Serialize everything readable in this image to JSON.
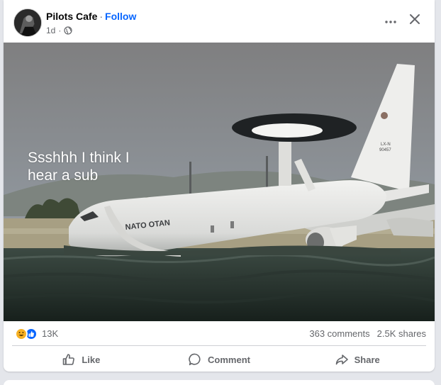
{
  "post": {
    "page_name": "Pilots Cafe",
    "separator": "·",
    "follow_label": "Follow",
    "time": "1d",
    "meta_separator": "·",
    "audience_icon": "globe-icon",
    "more_icon": "more-horizontal-icon",
    "close_icon": "close-icon"
  },
  "image": {
    "caption_line1": "Ssshhh I think I",
    "caption_line2": "hear a sub",
    "plane_marking": "NATO OTAN",
    "tail_marking_1": "LX-N",
    "tail_marking_2": "90457"
  },
  "stats": {
    "reaction_icons": [
      "haha-icon",
      "like-icon"
    ],
    "reaction_count": "13K",
    "comments": "363 comments",
    "shares": "2.5K shares"
  },
  "actions": [
    {
      "label": "Like",
      "icon": "thumbs-up-icon"
    },
    {
      "label": "Comment",
      "icon": "comment-icon"
    },
    {
      "label": "Share",
      "icon": "share-icon"
    }
  ],
  "colors": {
    "accent": "#0866ff",
    "secondary_text": "#65676b",
    "divider": "#ced0d4",
    "haha": "#f7b125"
  }
}
